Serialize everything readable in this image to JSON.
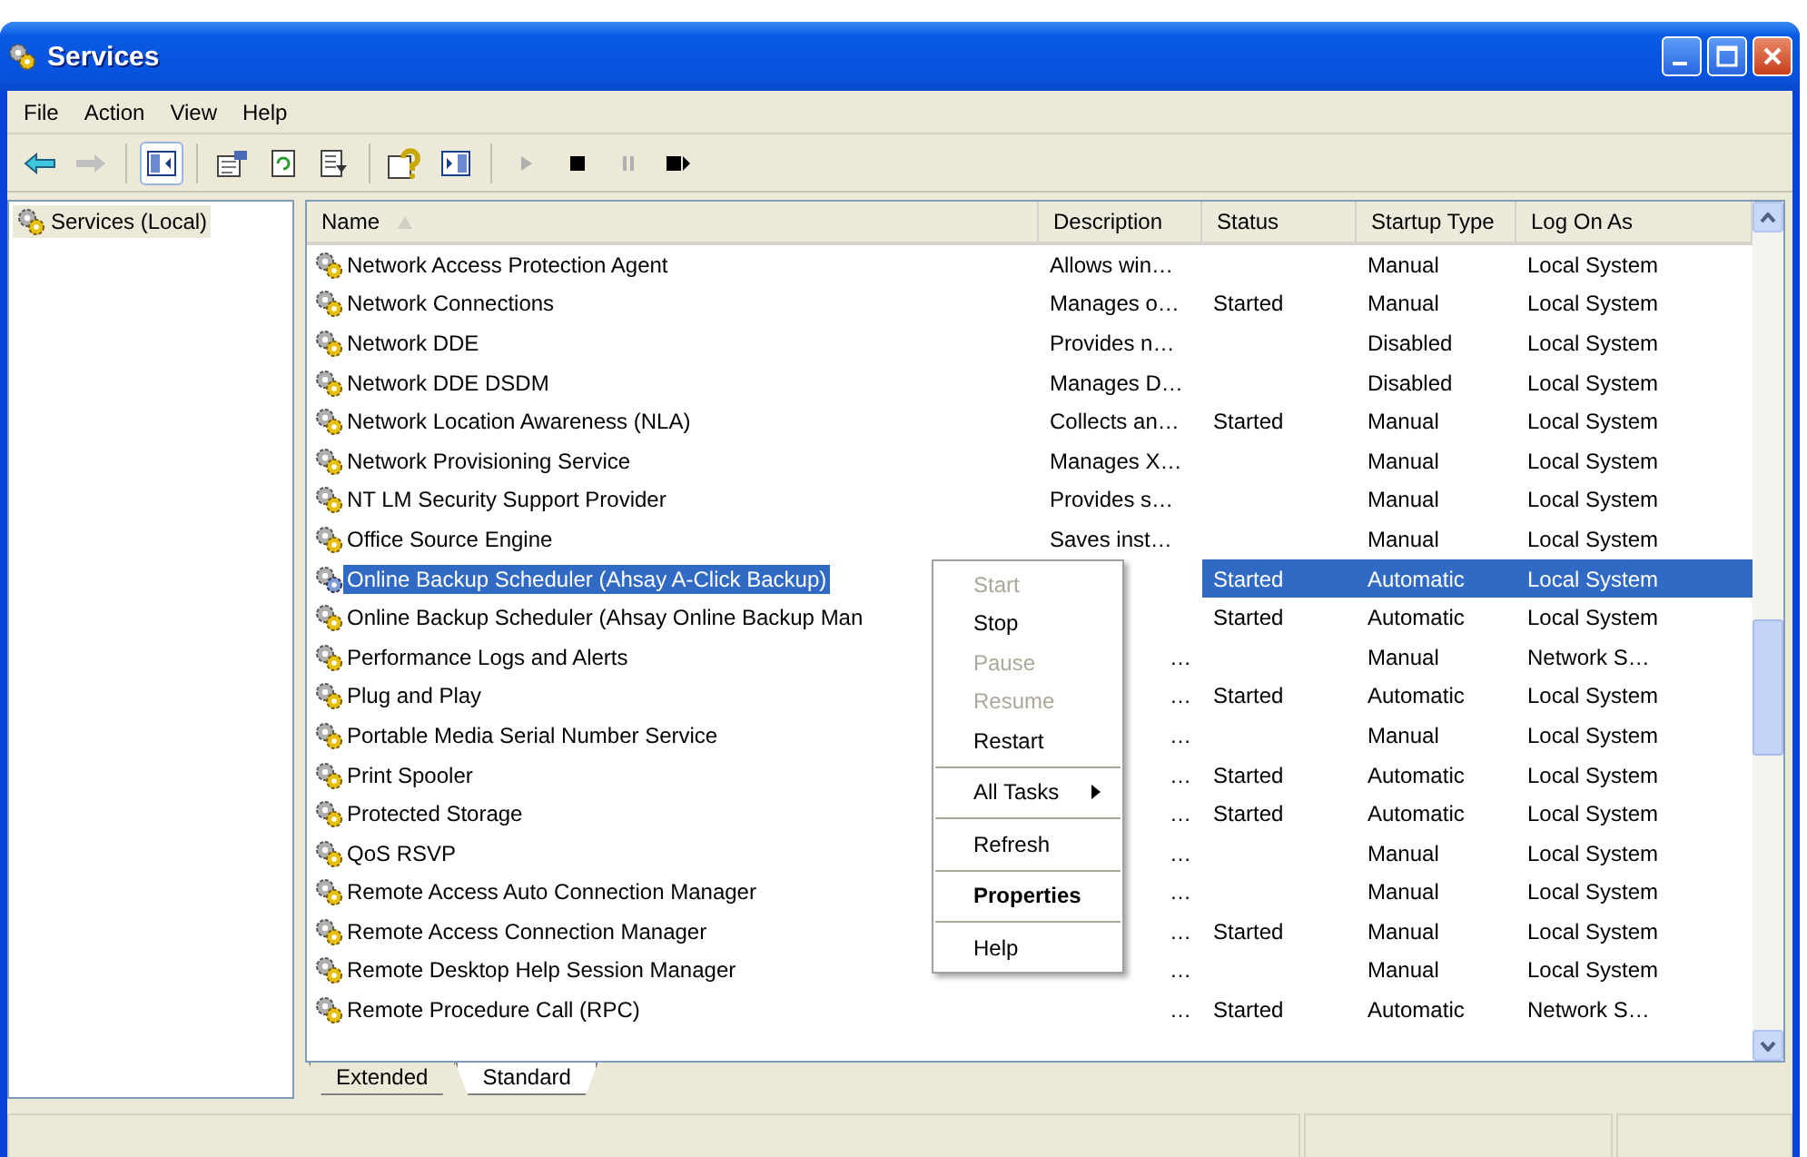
{
  "window": {
    "title": "Services"
  },
  "menu": [
    "File",
    "Action",
    "View",
    "Help"
  ],
  "tree": [
    {
      "label": "Services (Local)",
      "selected": true
    }
  ],
  "table": {
    "columns": [
      "Name",
      "Description",
      "Status",
      "Startup Type",
      "Log On As"
    ],
    "rows": [
      {
        "name": "Network Access Protection Agent",
        "description": "Allows win…",
        "status": "",
        "startup": "Manual",
        "logon": "Local System",
        "selected": false
      },
      {
        "name": "Network Connections",
        "description": "Manages o…",
        "status": "Started",
        "startup": "Manual",
        "logon": "Local System",
        "selected": false
      },
      {
        "name": "Network DDE",
        "description": "Provides n…",
        "status": "",
        "startup": "Disabled",
        "logon": "Local System",
        "selected": false
      },
      {
        "name": "Network DDE DSDM",
        "description": "Manages D…",
        "status": "",
        "startup": "Disabled",
        "logon": "Local System",
        "selected": false
      },
      {
        "name": "Network Location Awareness (NLA)",
        "description": "Collects an…",
        "status": "Started",
        "startup": "Manual",
        "logon": "Local System",
        "selected": false
      },
      {
        "name": "Network Provisioning Service",
        "description": "Manages X…",
        "status": "",
        "startup": "Manual",
        "logon": "Local System",
        "selected": false
      },
      {
        "name": "NT LM Security Support Provider",
        "description": "Provides s…",
        "status": "",
        "startup": "Manual",
        "logon": "Local System",
        "selected": false
      },
      {
        "name": "Office Source Engine",
        "description": "Saves inst…",
        "status": "",
        "startup": "Manual",
        "logon": "Local System",
        "selected": false
      },
      {
        "name": "Online Backup Scheduler (Ahsay A-Click Backup)",
        "description": "",
        "status": "Started",
        "startup": "Automatic",
        "logon": "Local System",
        "selected": true
      },
      {
        "name": "Online Backup Scheduler (Ahsay Online Backup Man",
        "description": "",
        "status": "Started",
        "startup": "Automatic",
        "logon": "Local System",
        "selected": false
      },
      {
        "name": "Performance Logs and Alerts",
        "description": "…",
        "status": "",
        "startup": "Manual",
        "logon": "Network S…",
        "selected": false
      },
      {
        "name": "Plug and Play",
        "description": "…",
        "status": "Started",
        "startup": "Automatic",
        "logon": "Local System",
        "selected": false
      },
      {
        "name": "Portable Media Serial Number Service",
        "description": "…",
        "status": "",
        "startup": "Manual",
        "logon": "Local System",
        "selected": false
      },
      {
        "name": "Print Spooler",
        "description": "…",
        "status": "Started",
        "startup": "Automatic",
        "logon": "Local System",
        "selected": false
      },
      {
        "name": "Protected Storage",
        "description": "…",
        "status": "Started",
        "startup": "Automatic",
        "logon": "Local System",
        "selected": false
      },
      {
        "name": "QoS RSVP",
        "description": "…",
        "status": "",
        "startup": "Manual",
        "logon": "Local System",
        "selected": false
      },
      {
        "name": "Remote Access Auto Connection Manager",
        "description": "…",
        "status": "",
        "startup": "Manual",
        "logon": "Local System",
        "selected": false
      },
      {
        "name": "Remote Access Connection Manager",
        "description": "…",
        "status": "Started",
        "startup": "Manual",
        "logon": "Local System",
        "selected": false
      },
      {
        "name": "Remote Desktop Help Session Manager",
        "description": "…",
        "status": "",
        "startup": "Manual",
        "logon": "Local System",
        "selected": false
      },
      {
        "name": "Remote Procedure Call (RPC)",
        "description": "…",
        "status": "Started",
        "startup": "Automatic",
        "logon": "Network S…",
        "selected": false
      }
    ]
  },
  "context_menu": [
    {
      "kind": "item",
      "label": "Start",
      "disabled": true
    },
    {
      "kind": "item",
      "label": "Stop",
      "disabled": false
    },
    {
      "kind": "item",
      "label": "Pause",
      "disabled": true
    },
    {
      "kind": "item",
      "label": "Resume",
      "disabled": true
    },
    {
      "kind": "item",
      "label": "Restart",
      "disabled": false
    },
    {
      "kind": "separator"
    },
    {
      "kind": "submenu",
      "label": "All Tasks",
      "disabled": false
    },
    {
      "kind": "separator"
    },
    {
      "kind": "item",
      "label": "Refresh",
      "disabled": false
    },
    {
      "kind": "separator"
    },
    {
      "kind": "default",
      "label": "Properties",
      "disabled": false
    },
    {
      "kind": "separator"
    },
    {
      "kind": "item",
      "label": "Help",
      "disabled": false
    }
  ],
  "view_tabs": [
    {
      "label": "Extended",
      "selected": false
    },
    {
      "label": "Standard",
      "selected": true
    }
  ]
}
